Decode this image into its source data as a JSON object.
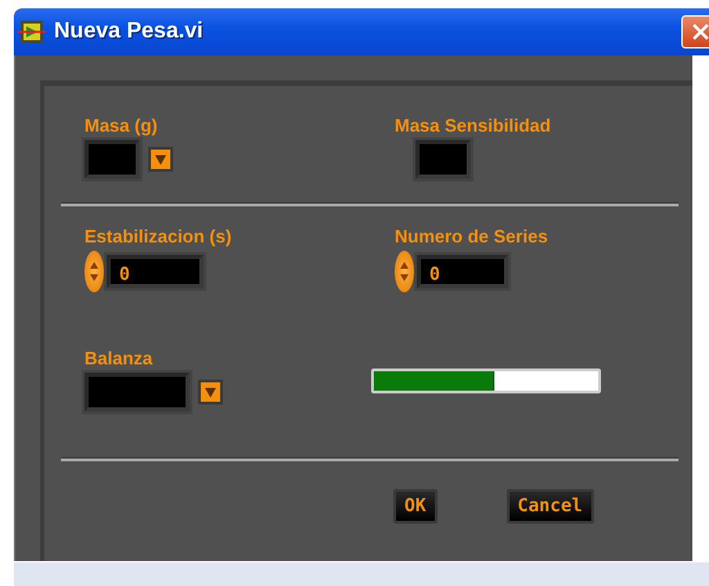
{
  "window": {
    "title": "Nueva Pesa.vi"
  },
  "sections": [
    {
      "controls": [
        {
          "kind": "ring",
          "label": "Masa (g)"
        },
        {
          "kind": "indicator",
          "label": "Masa Sensibilidad"
        }
      ]
    },
    {
      "controls": [
        {
          "kind": "numeric",
          "label": "Estabilizacion (s)",
          "value": "0"
        },
        {
          "kind": "numeric",
          "label": "Numero de Series",
          "value": "0"
        }
      ]
    },
    {
      "controls": [
        {
          "kind": "ring",
          "label": "Balanza"
        },
        {
          "kind": "progress",
          "level": 0.54
        }
      ]
    }
  ],
  "buttons": [
    "OK",
    "Cancel"
  ]
}
